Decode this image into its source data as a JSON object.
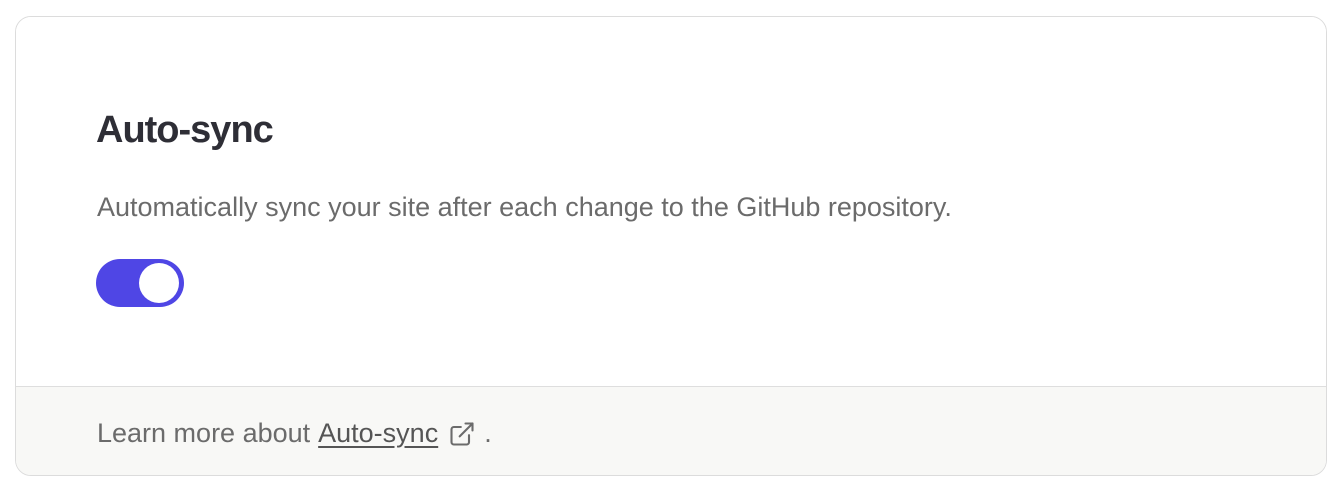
{
  "card": {
    "title": "Auto-sync",
    "description": "Automatically sync your site after each change to the GitHub repository.",
    "toggle": {
      "state": "on",
      "accent_color": "#4f46e5"
    }
  },
  "footer": {
    "prefix": "Learn more about",
    "link_label": "Auto-sync",
    "link_icon": "external-link-icon",
    "suffix": "."
  }
}
